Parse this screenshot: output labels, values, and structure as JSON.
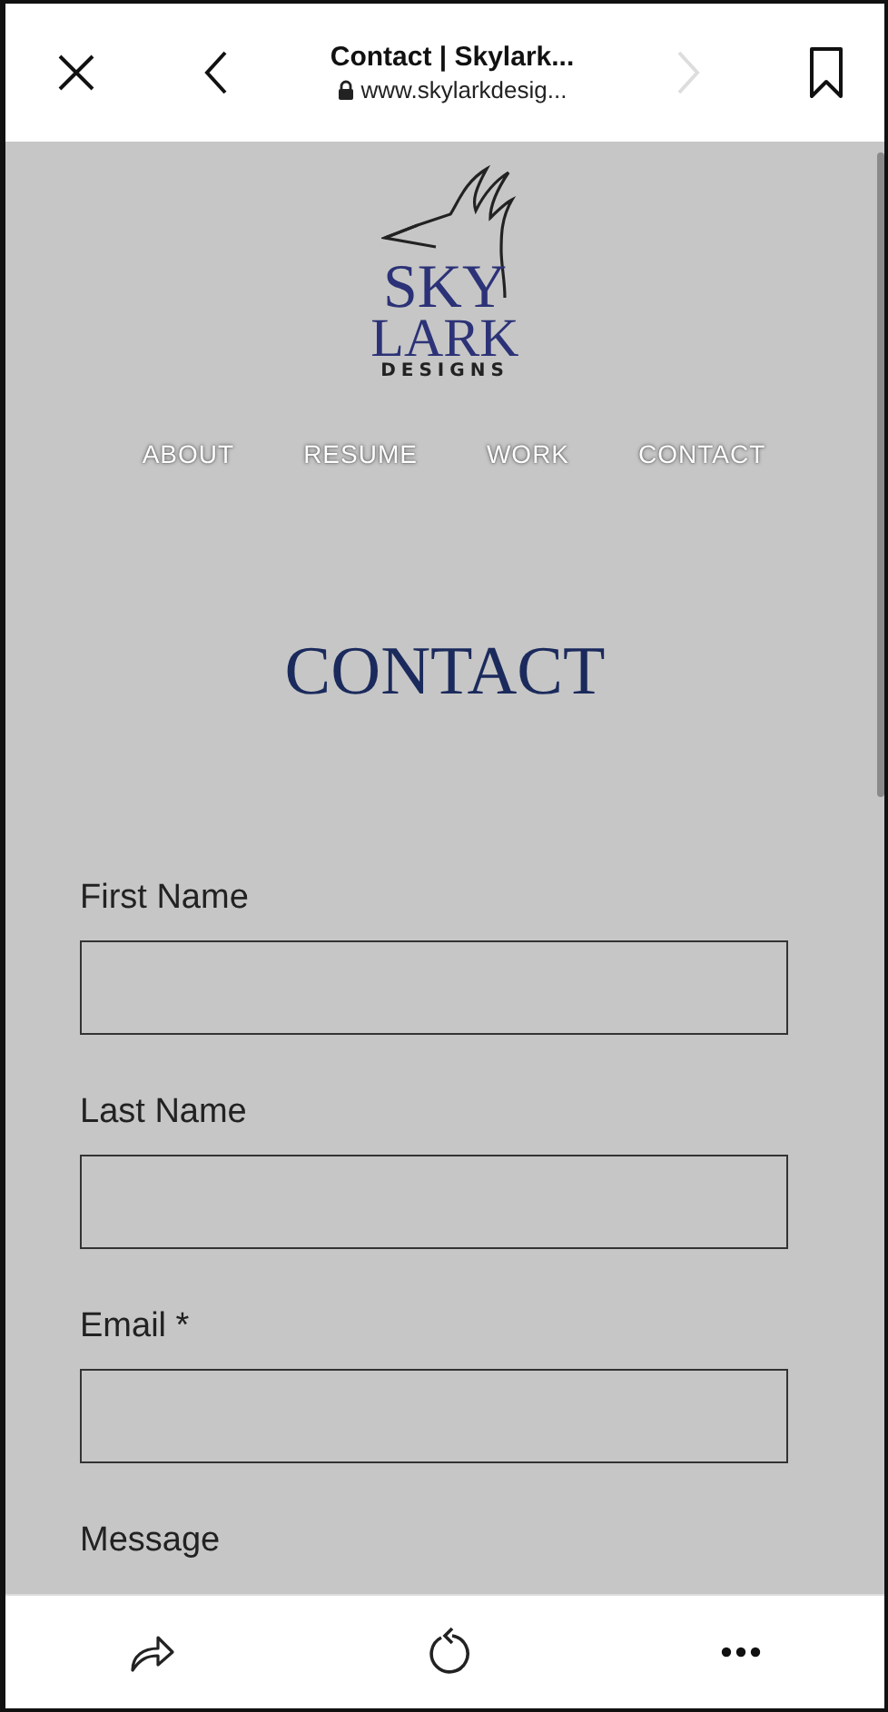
{
  "browser": {
    "title": "Contact | Skylark...",
    "url": "www.skylarkdesig...",
    "forward_disabled": true
  },
  "logo": {
    "line_1": "SKY",
    "line_2": "LARK",
    "line_3": "DESIGNS"
  },
  "nav": [
    {
      "label": "ABOUT"
    },
    {
      "label": "RESUME"
    },
    {
      "label": "WORK"
    },
    {
      "label": "CONTACT"
    }
  ],
  "heading": "CONTACT",
  "form": [
    {
      "label": "First Name",
      "kind": "input"
    },
    {
      "label": "Last Name",
      "kind": "input"
    },
    {
      "label": "Email *",
      "kind": "input"
    },
    {
      "label": "Message",
      "kind": "label"
    }
  ]
}
